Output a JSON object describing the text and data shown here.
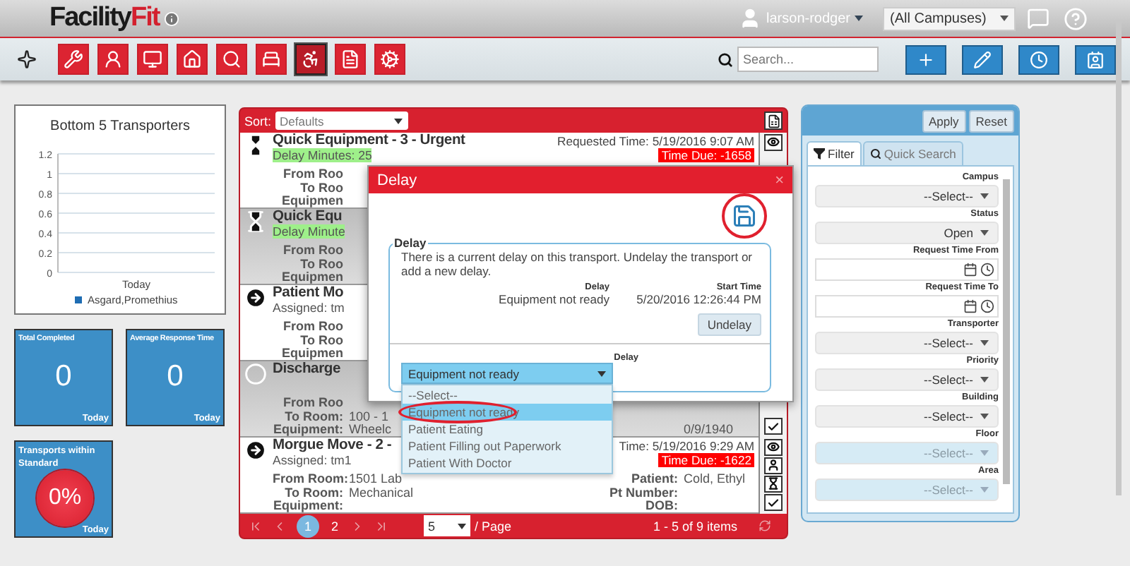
{
  "header": {
    "logo": [
      "Facility",
      "Fit"
    ],
    "user": "larson-rodger",
    "campus": "(All Campuses)"
  },
  "toolbar": {
    "tools": [
      {
        "selected": false
      },
      {
        "selected": false
      },
      {
        "selected": false
      },
      {
        "selected": false
      },
      {
        "selected": false
      },
      {
        "selected": false
      },
      {
        "selected": true
      },
      {
        "selected": false
      },
      {
        "selected": false
      }
    ],
    "search": {
      "placeholder": "Search..."
    }
  },
  "chart": {
    "chart_data": {
      "type": "bar",
      "title": "Bottom 5 Transporters",
      "categories": [
        "Today"
      ],
      "ylim": [
        0,
        1.2
      ],
      "yticks": [
        0,
        0.2,
        0.4,
        0.6,
        0.8,
        1,
        1.2
      ],
      "grid": true,
      "series": [
        {
          "name": "Asgard,Promethius",
          "color": "#1f6db3",
          "values": [
            0
          ]
        }
      ]
    }
  },
  "tiles": [
    {
      "kind": "number",
      "title": "Total Completed",
      "value": "0",
      "period": "Today"
    },
    {
      "kind": "number",
      "title": "Average Response Time",
      "value": "0",
      "period": "Today"
    },
    {
      "kind": "gauge",
      "title": "Transports within Standard",
      "value": "0%",
      "period": "Today"
    }
  ],
  "list": {
    "sort_label": "Sort:",
    "sort": "Defaults",
    "rows": [
      {
        "kind": "delayed",
        "title": "Quick Equipment - 3 - Urgent",
        "note": {
          "kind": "delay",
          "text": "Delay Minutes: 25"
        },
        "requested": "Requested Time: 5/19/2016 9:07 AM",
        "due": "Time Due: -1658",
        "details": [
          {
            "label": "From Roo"
          },
          {
            "label": "To Roo"
          },
          {
            "label": "Equipmen"
          }
        ],
        "actions": [
          {
            "kind": "view"
          }
        ]
      },
      {
        "kind": "delayed",
        "title": "Quick Equ",
        "note": {
          "kind": "delay",
          "text": "Delay Minute"
        },
        "details": [
          {
            "label": "From Roo"
          },
          {
            "label": "To Roo"
          },
          {
            "label": "Equipmen"
          }
        ]
      },
      {
        "kind": "en_route",
        "title": "Patient Mo",
        "note": {
          "kind": "assigned",
          "text": "Assigned: tm"
        },
        "details": [
          {
            "label": "From Roo"
          },
          {
            "label": "To Roo"
          },
          {
            "label": "Equipmen"
          }
        ]
      },
      {
        "kind": "pending",
        "title": "Discharge",
        "details": [
          {
            "label": "From Roo"
          },
          {
            "label": "To Room:",
            "value": "100 - 1"
          },
          {
            "label": "Equipment:",
            "value": "Wheelc"
          }
        ],
        "info": [
          {
            "value": "0/9/1940"
          }
        ],
        "actions": [
          {
            "kind": "complete"
          }
        ]
      },
      {
        "kind": "en_route",
        "title": "Morgue Move - 2 -",
        "note": {
          "kind": "assigned",
          "text": "Assigned: tm1"
        },
        "requested": "Time: 5/19/2016 9:29 AM",
        "due": "Time Due: -1622",
        "details": [
          {
            "label": "From Room:",
            "value": "1501 Lab"
          },
          {
            "label": "To Room:",
            "value": "Mechanical"
          },
          {
            "label": "Equipment:"
          }
        ],
        "info": [
          {
            "label": "Patient:",
            "value": "Cold, Ethyl"
          },
          {
            "label": "Pt Number:"
          },
          {
            "label": "DOB:"
          }
        ],
        "actions": [
          {
            "kind": "view"
          },
          {
            "kind": "assign"
          },
          {
            "kind": "delay"
          },
          {
            "kind": "complete"
          }
        ]
      }
    ],
    "pager": {
      "pages": [
        {
          "label": "1",
          "selected": true
        },
        {
          "label": "2",
          "selected": false
        }
      ],
      "page_size": "5",
      "page_label": "/ Page",
      "summary": "1 - 5 of 9 items"
    }
  },
  "dialog": {
    "title": "Delay",
    "close": "×",
    "legend": "Delay",
    "message": "There is a current delay on this transport. Undelay the transport or add a new delay.",
    "columns": [
      {
        "heading": "Delay",
        "value": "Equipment not ready"
      },
      {
        "heading": "Start Time",
        "value": "5/20/2016 12:26:44 PM"
      }
    ],
    "button": "Undelay",
    "select_label": "Delay",
    "select_value": "Equipment not ready",
    "options": [
      {
        "label": "--Select--",
        "selected": false
      },
      {
        "label": "Equipment not ready",
        "selected": true
      },
      {
        "label": "Patient Eating",
        "selected": false
      },
      {
        "label": "Patient Filling out Paperwork",
        "selected": false
      },
      {
        "label": "Patient With Doctor",
        "selected": false
      }
    ]
  },
  "filter": {
    "buttons": [
      "Apply",
      "Reset"
    ],
    "tabs": [
      {
        "label": "Filter",
        "selected": true
      },
      {
        "label": "Quick Search",
        "selected": false
      }
    ],
    "fields": [
      {
        "label": "Campus",
        "kind": "select",
        "value": "--Select--",
        "disabled": false
      },
      {
        "label": "Status",
        "kind": "select",
        "value": "Open",
        "disabled": false
      },
      {
        "label": "Request Time From",
        "kind": "datetime",
        "disabled": false
      },
      {
        "label": "Request Time To",
        "kind": "datetime",
        "disabled": false
      },
      {
        "label": "Transporter",
        "kind": "select",
        "value": "--Select--",
        "disabled": false
      },
      {
        "label": "Priority",
        "kind": "select",
        "value": "--Select--",
        "disabled": false
      },
      {
        "label": "Building",
        "kind": "select",
        "value": "--Select--",
        "disabled": false
      },
      {
        "label": "Floor",
        "kind": "select",
        "value": "--Select--",
        "disabled": true
      },
      {
        "label": "Area",
        "kind": "select",
        "value": "--Select--",
        "disabled": true
      }
    ]
  }
}
